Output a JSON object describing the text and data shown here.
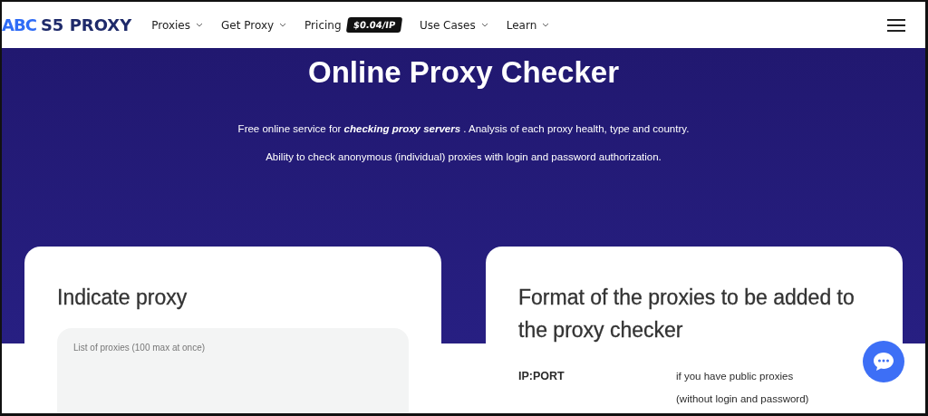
{
  "header": {
    "logo_mark": "ABC",
    "logo_text": "S5 PROXY",
    "nav": [
      {
        "label": "Proxies",
        "has_dropdown": true
      },
      {
        "label": "Get Proxy",
        "has_dropdown": true
      },
      {
        "label": "Pricing",
        "has_dropdown": false,
        "badge": "$0.04/IP"
      },
      {
        "label": "Use Cases",
        "has_dropdown": true
      },
      {
        "label": "Learn",
        "has_dropdown": true
      }
    ]
  },
  "hero": {
    "title": "Online Proxy Checker",
    "paragraphs": [
      "Free online service for *checking proxy servers* . Analysis of each proxy health, type and country.",
      "Ability to check anonymous (individual) proxies with login and password authorization."
    ]
  },
  "cards": [
    {
      "kind": "input",
      "title": "Indicate proxy",
      "placeholder": "List of proxies (100 max at once)"
    },
    {
      "kind": "formats",
      "title": "Format of the proxies to be added to the proxy checker",
      "rows": [
        {
          "format": "IP:PORT",
          "description": "if you have public proxies (without login and password)"
        }
      ]
    }
  ]
}
